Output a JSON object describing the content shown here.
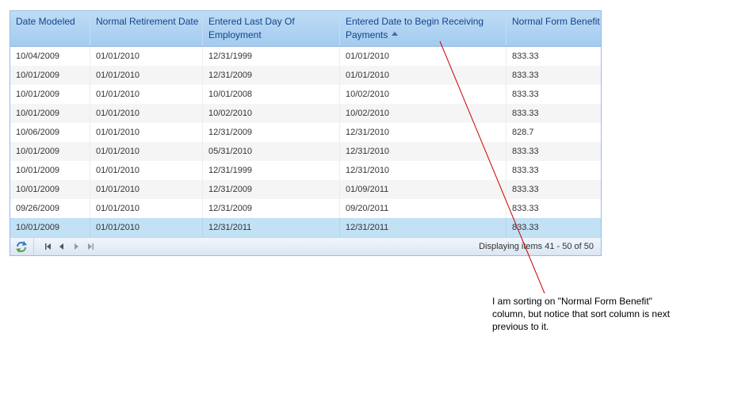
{
  "grid": {
    "columns": [
      {
        "label": "Date Modeled"
      },
      {
        "label": "Normal Retirement Date"
      },
      {
        "label": "Entered Last Day Of Employment"
      },
      {
        "label": "Entered Date to Begin Receiving Payments",
        "sorted": "asc"
      },
      {
        "label": "Normal Form Benefit"
      }
    ],
    "rows": [
      [
        "10/04/2009",
        "01/01/2010",
        "12/31/1999",
        "01/01/2010",
        "833.33"
      ],
      [
        "10/01/2009",
        "01/01/2010",
        "12/31/2009",
        "01/01/2010",
        "833.33"
      ],
      [
        "10/01/2009",
        "01/01/2010",
        "10/01/2008",
        "10/02/2010",
        "833.33"
      ],
      [
        "10/01/2009",
        "01/01/2010",
        "10/02/2010",
        "10/02/2010",
        "833.33"
      ],
      [
        "10/06/2009",
        "01/01/2010",
        "12/31/2009",
        "12/31/2010",
        "828.7"
      ],
      [
        "10/01/2009",
        "01/01/2010",
        "05/31/2010",
        "12/31/2010",
        "833.33"
      ],
      [
        "10/01/2009",
        "01/01/2010",
        "12/31/1999",
        "12/31/2010",
        "833.33"
      ],
      [
        "10/01/2009",
        "01/01/2010",
        "12/31/2009",
        "01/09/2011",
        "833.33"
      ],
      [
        "09/26/2009",
        "01/01/2010",
        "12/31/2009",
        "09/20/2011",
        "833.33"
      ],
      [
        "10/01/2009",
        "01/01/2010",
        "12/31/2011",
        "12/31/2011",
        "833.33"
      ]
    ],
    "selected_row": 9
  },
  "pager": {
    "status": "Displaying items 41 - 50 of 50",
    "icons": [
      "refresh-icon",
      "first-page-icon",
      "prev-page-icon",
      "next-page-icon",
      "last-page-icon"
    ]
  },
  "annotation": {
    "text": "I am sorting on \"Normal Form Benefit\" column, but notice that sort column is next previous to it."
  },
  "colors": {
    "header_text": "#15428b",
    "selected_row": "#c2e1f5",
    "annotation_line": "#cc0000"
  }
}
